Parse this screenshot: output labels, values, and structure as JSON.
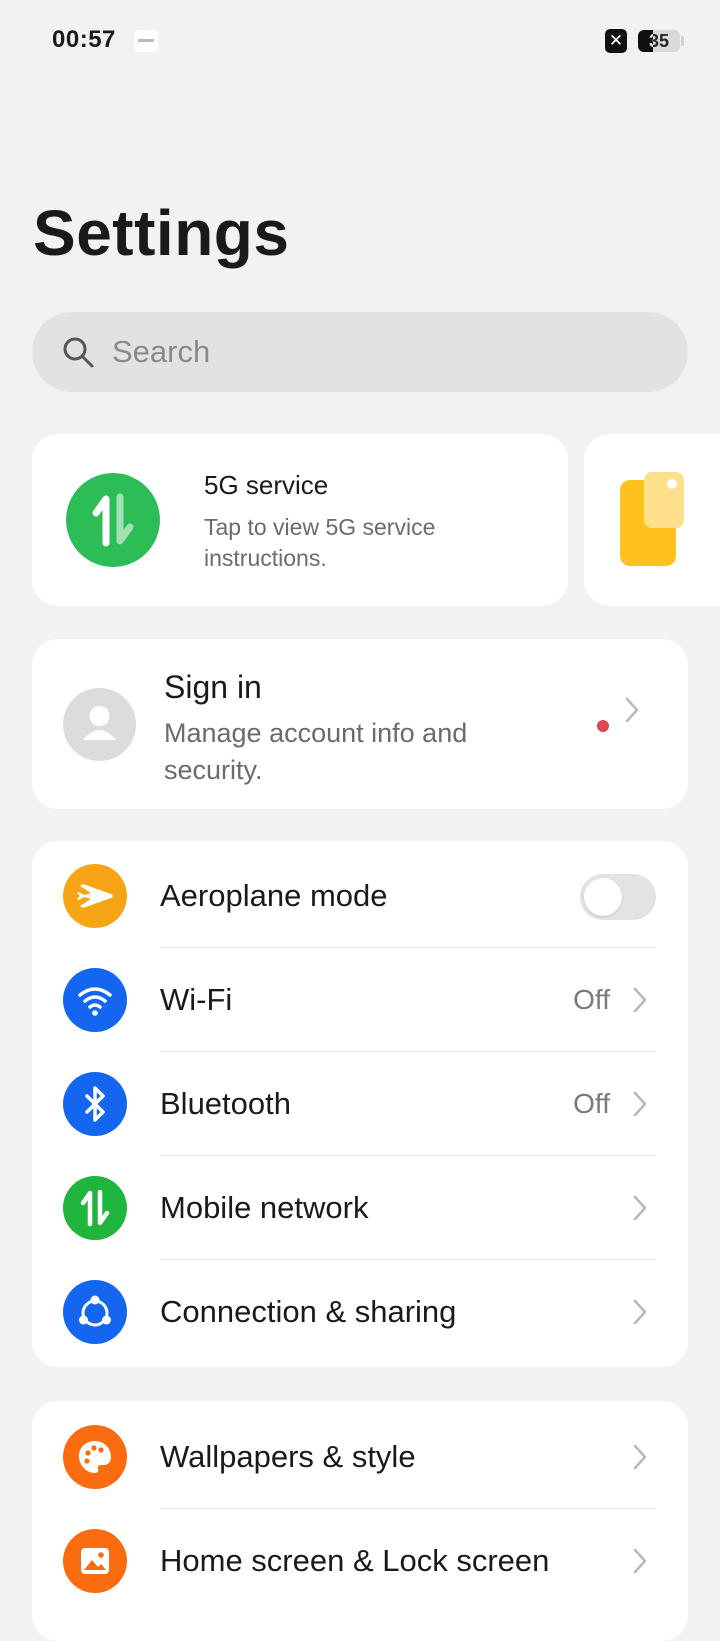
{
  "status_bar": {
    "time": "00:57",
    "sim_status_icon": "sim-x-icon",
    "battery_level": 35,
    "battery_text": "35"
  },
  "page_title": "Settings",
  "search": {
    "placeholder": "Search"
  },
  "promo_card": {
    "title": "5G service",
    "description": "Tap to view 5G service instructions.",
    "icon": "data-arrows-icon",
    "icon_color": "#2dbd57"
  },
  "account": {
    "title": "Sign in",
    "description": "Manage account info and security.",
    "has_notification": true,
    "notification_color": "#e0464f"
  },
  "connectivity": [
    {
      "id": "aeroplane",
      "label": "Aeroplane mode",
      "icon": "airplane-icon",
      "color": "#f8a515",
      "control": "toggle",
      "enabled": false
    },
    {
      "id": "wifi",
      "label": "Wi-Fi",
      "icon": "wifi-icon",
      "color": "#1466f0",
      "value": "Off"
    },
    {
      "id": "bluetooth",
      "label": "Bluetooth",
      "icon": "bluetooth-icon",
      "color": "#1466f0",
      "value": "Off"
    },
    {
      "id": "mobile-network",
      "label": "Mobile network",
      "icon": "data-arrows-icon",
      "color": "#20b53c",
      "value": ""
    },
    {
      "id": "connection-sharing",
      "label": "Connection & sharing",
      "icon": "share-icon",
      "color": "#1466f0",
      "value": ""
    }
  ],
  "personalization": [
    {
      "id": "wallpapers",
      "label": "Wallpapers & style",
      "icon": "palette-icon",
      "color": "#fb6c11"
    },
    {
      "id": "home-lock",
      "label": "Home screen & Lock screen",
      "icon": "picture-icon",
      "color": "#fb6c11"
    }
  ]
}
